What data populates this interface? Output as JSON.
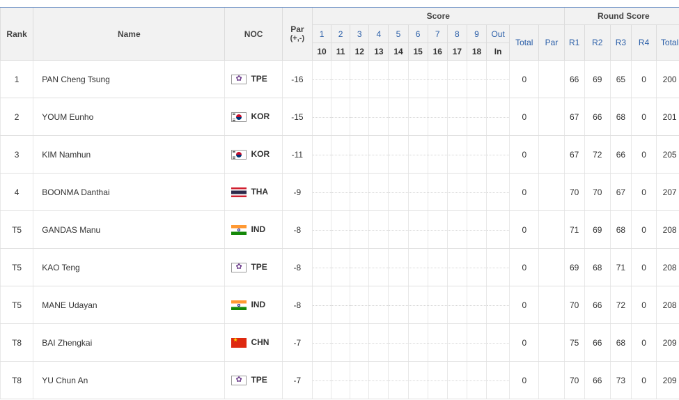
{
  "header": {
    "rank": "Rank",
    "name": "Name",
    "noc": "NOC",
    "par_line1": "Par",
    "par_line2": "(+,-)",
    "score": "Score",
    "round_score": "Round Score",
    "front_holes": [
      "1",
      "2",
      "3",
      "4",
      "5",
      "6",
      "7",
      "8",
      "9",
      "Out"
    ],
    "back_holes": [
      "10",
      "11",
      "12",
      "13",
      "14",
      "15",
      "16",
      "17",
      "18",
      "In"
    ],
    "total": "Total",
    "par": "Par",
    "rounds": [
      "R1",
      "R2",
      "R3",
      "R4"
    ],
    "round_total": "Total"
  },
  "rows": [
    {
      "rank": "1",
      "name": "PAN Cheng Tsung",
      "flag": "tpe",
      "noc": "TPE",
      "par": "-16",
      "total": "0",
      "rpar": "",
      "r1": "66",
      "r2": "69",
      "r3": "65",
      "r4": "0",
      "rtotal": "200"
    },
    {
      "rank": "2",
      "name": "YOUM Eunho",
      "flag": "kor",
      "noc": "KOR",
      "par": "-15",
      "total": "0",
      "rpar": "",
      "r1": "67",
      "r2": "66",
      "r3": "68",
      "r4": "0",
      "rtotal": "201"
    },
    {
      "rank": "3",
      "name": "KIM Namhun",
      "flag": "kor",
      "noc": "KOR",
      "par": "-11",
      "total": "0",
      "rpar": "",
      "r1": "67",
      "r2": "72",
      "r3": "66",
      "r4": "0",
      "rtotal": "205"
    },
    {
      "rank": "4",
      "name": "BOONMA Danthai",
      "flag": "tha",
      "noc": "THA",
      "par": "-9",
      "total": "0",
      "rpar": "",
      "r1": "70",
      "r2": "70",
      "r3": "67",
      "r4": "0",
      "rtotal": "207"
    },
    {
      "rank": "T5",
      "name": "GANDAS Manu",
      "flag": "ind",
      "noc": "IND",
      "par": "-8",
      "total": "0",
      "rpar": "",
      "r1": "71",
      "r2": "69",
      "r3": "68",
      "r4": "0",
      "rtotal": "208"
    },
    {
      "rank": "T5",
      "name": "KAO Teng",
      "flag": "tpe",
      "noc": "TPE",
      "par": "-8",
      "total": "0",
      "rpar": "",
      "r1": "69",
      "r2": "68",
      "r3": "71",
      "r4": "0",
      "rtotal": "208"
    },
    {
      "rank": "T5",
      "name": "MANE Udayan",
      "flag": "ind",
      "noc": "IND",
      "par": "-8",
      "total": "0",
      "rpar": "",
      "r1": "70",
      "r2": "66",
      "r3": "72",
      "r4": "0",
      "rtotal": "208"
    },
    {
      "rank": "T8",
      "name": "BAI Zhengkai",
      "flag": "chn",
      "noc": "CHN",
      "par": "-7",
      "total": "0",
      "rpar": "",
      "r1": "75",
      "r2": "66",
      "r3": "68",
      "r4": "0",
      "rtotal": "209"
    },
    {
      "rank": "T8",
      "name": "YU Chun An",
      "flag": "tpe",
      "noc": "TPE",
      "par": "-7",
      "total": "0",
      "rpar": "",
      "r1": "70",
      "r2": "66",
      "r3": "73",
      "r4": "0",
      "rtotal": "209"
    }
  ],
  "colors": {
    "header_bg": "#f2f2f2",
    "accent_blue": "#2a5ea8",
    "top_rule": "#6a8fc4"
  }
}
